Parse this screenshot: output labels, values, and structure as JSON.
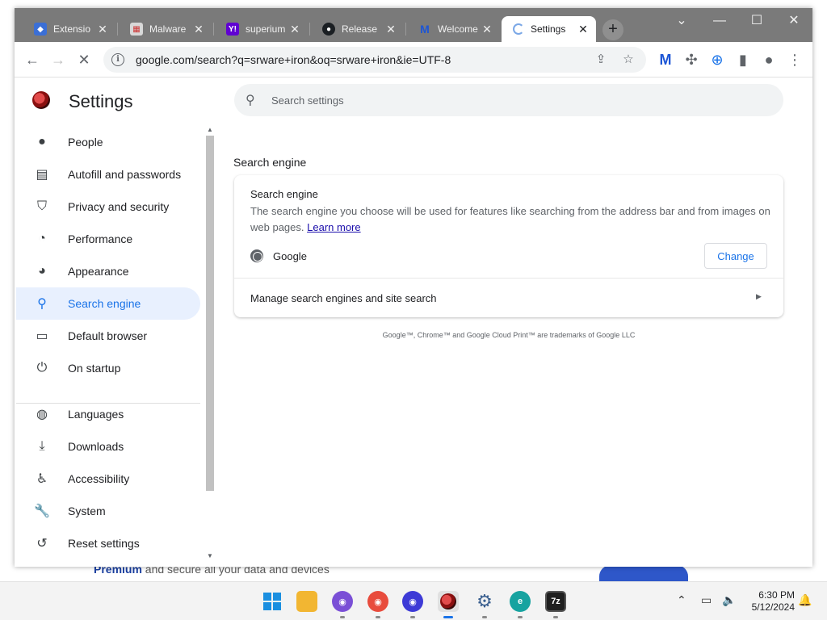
{
  "colors": {
    "accent": "#1a73e8",
    "nav_active_bg": "#e8f0fe",
    "titlebar": "#7a7a7a"
  },
  "tabs": [
    {
      "title": "Extensio",
      "favicon": "puzzle-icon"
    },
    {
      "title": "Malware",
      "favicon": "malwarebytes-site-icon"
    },
    {
      "title": "superium",
      "favicon": "yahoo-icon"
    },
    {
      "title": "Release",
      "favicon": "github-icon"
    },
    {
      "title": "Welcome",
      "favicon": "malwarebytes-icon"
    },
    {
      "title": "Settings",
      "favicon": "loading-spinner-icon",
      "active": true
    }
  ],
  "tab_close_glyph": "✕",
  "new_tab_glyph": "+",
  "omnibox": {
    "url": "google.com/search?q=srware+iron&oq=srware+iron&ie=UTF-8"
  },
  "settings": {
    "title": "Settings",
    "search_placeholder": "Search settings",
    "nav": [
      {
        "label": "People",
        "icon": "person-icon"
      },
      {
        "label": "Autofill and passwords",
        "icon": "clipboard-icon"
      },
      {
        "label": "Privacy and security",
        "icon": "shield-icon"
      },
      {
        "label": "Performance",
        "icon": "speedometer-icon"
      },
      {
        "label": "Appearance",
        "icon": "palette-icon"
      },
      {
        "label": "Search engine",
        "icon": "search-icon",
        "active": true
      },
      {
        "label": "Default browser",
        "icon": "browser-window-icon"
      },
      {
        "label": "On startup",
        "icon": "power-icon"
      },
      {
        "label": "Languages",
        "icon": "globe-icon"
      },
      {
        "label": "Downloads",
        "icon": "download-icon"
      },
      {
        "label": "Accessibility",
        "icon": "accessibility-icon"
      },
      {
        "label": "System",
        "icon": "wrench-icon"
      },
      {
        "label": "Reset settings",
        "icon": "reset-icon"
      }
    ],
    "section_heading": "Search engine",
    "card": {
      "title": "Search engine",
      "description": "The search engine you choose will be used for features like searching from the address bar and from images on web pages.",
      "learn_more": "Learn more",
      "engine_name": "Google",
      "change_label": "Change",
      "manage_label": "Manage search engines and site search"
    },
    "trademark": "Google™, Chrome™ and Google Cloud Print™ are trademarks of Google LLC"
  },
  "background_banner": {
    "bold": "Premium",
    "rest": " and secure all your data and devices"
  },
  "taskbar": {
    "time": "6:30 PM",
    "date": "5/12/2024",
    "sevenzip_label": "7z"
  }
}
